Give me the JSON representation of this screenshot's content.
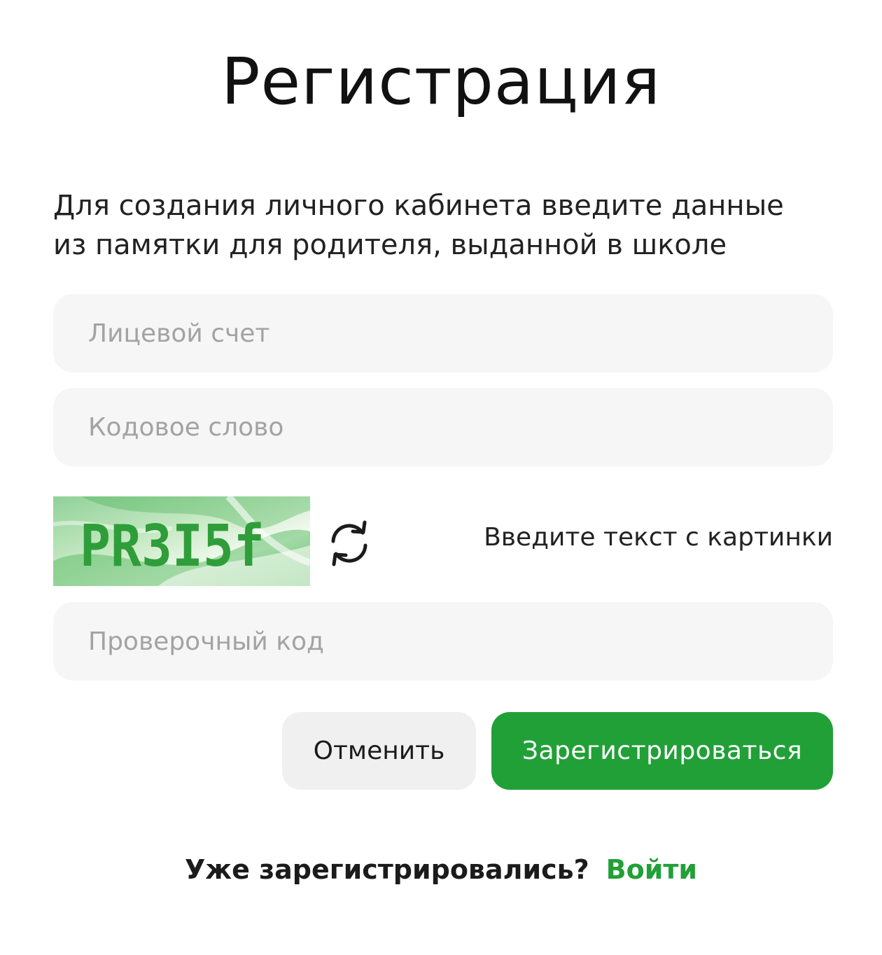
{
  "page": {
    "title": "Регистрация",
    "intro_line1": "Для создания личного кабинета введите данные",
    "intro_line2": "из памятки для родителя, выданной в школе"
  },
  "form": {
    "account_placeholder": "Лицевой счет",
    "account_value": "",
    "codeword_placeholder": "Кодовое слово",
    "codeword_value": "",
    "captcha_text": "PR3I5f",
    "captcha_hint": "Введите текст с картинки",
    "refresh_icon": "refresh-icon",
    "verify_placeholder": "Проверочный код",
    "verify_value": ""
  },
  "actions": {
    "cancel_label": "Отменить",
    "register_label": "Зарегистрироваться"
  },
  "footer": {
    "already_text": "Уже зарегистрировались?",
    "login_label": "Войти"
  },
  "colors": {
    "brand_green": "#21a038",
    "field_bg": "#f6f6f6",
    "cancel_bg": "#f0f0f0",
    "captcha_text_green": "#2f9e3a"
  }
}
